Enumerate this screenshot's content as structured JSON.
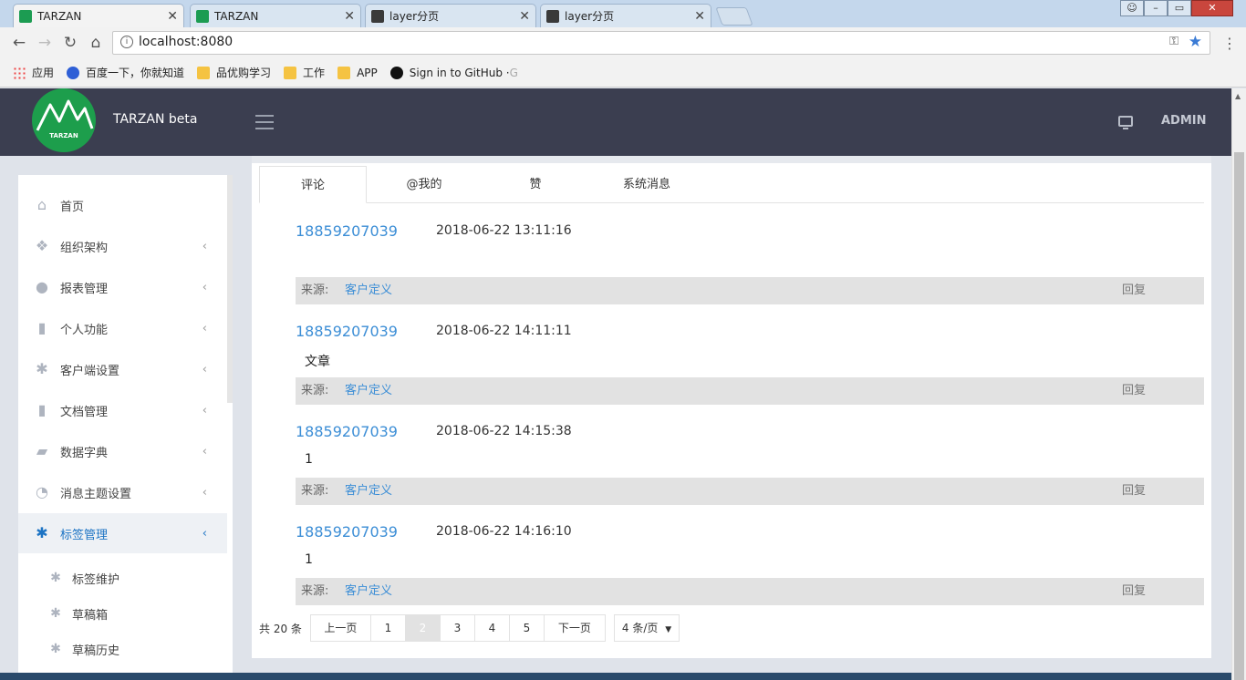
{
  "browser": {
    "tabs": [
      {
        "title": "TARZAN",
        "favicon": "tarzan-icon",
        "active": true
      },
      {
        "title": "TARZAN",
        "favicon": "tarzan-icon",
        "active": false
      },
      {
        "title": "layer分页",
        "favicon": "intellij-icon",
        "active": false
      },
      {
        "title": "layer分页",
        "favicon": "intellij-icon",
        "active": false
      }
    ],
    "close_glyph": "✕",
    "url": "localhost:8080",
    "bookmarks": [
      {
        "label": "应用",
        "icon": "apps-icon"
      },
      {
        "label": "百度一下，你就知道",
        "icon": "baidu-icon"
      },
      {
        "label": "品优购学习",
        "icon": "folder-icon"
      },
      {
        "label": "工作",
        "icon": "folder-icon"
      },
      {
        "label": "APP",
        "icon": "folder-icon"
      },
      {
        "label": "Sign in to GitHub · ",
        "icon": "github-icon"
      }
    ],
    "bookmark_fade": "G"
  },
  "header": {
    "brand": "TARZAN beta",
    "logo_text": "TARZAN",
    "user": "ADMIN",
    "brand_color": "#3b3e50",
    "logo_color": "#1d9e4c"
  },
  "sidebar": {
    "items": [
      {
        "label": "首页",
        "icon": "home-icon",
        "glyph": "⌂",
        "has_children": false
      },
      {
        "label": "组织架构",
        "icon": "cubes-icon",
        "glyph": "❖",
        "has_children": true
      },
      {
        "label": "报表管理",
        "icon": "user-icon",
        "glyph": "●",
        "has_children": true
      },
      {
        "label": "个人功能",
        "icon": "file-icon",
        "glyph": "▮",
        "has_children": true
      },
      {
        "label": "客户端设置",
        "icon": "gear-icon",
        "glyph": "✱",
        "has_children": true
      },
      {
        "label": "文档管理",
        "icon": "file-icon",
        "glyph": "▮",
        "has_children": true
      },
      {
        "label": "数据字典",
        "icon": "folder-open-icon",
        "glyph": "▰",
        "has_children": true
      },
      {
        "label": "消息主题设置",
        "icon": "rss-icon",
        "glyph": "◔",
        "has_children": true
      },
      {
        "label": "标签管理",
        "icon": "gear-icon",
        "glyph": "✱",
        "has_children": true,
        "active": true
      }
    ],
    "sub_items": [
      {
        "label": "标签维护",
        "icon": "gear-icon",
        "glyph": "✱"
      },
      {
        "label": "草稿箱",
        "icon": "gear-icon",
        "glyph": "✱"
      },
      {
        "label": "草稿历史",
        "icon": "gear-icon",
        "glyph": "✱"
      }
    ],
    "chevron": "‹",
    "active_color": "#1d74c4"
  },
  "main": {
    "tabs": [
      "评论",
      "@我的",
      "赞",
      "系统消息"
    ],
    "comments": [
      {
        "user": "18859207039",
        "time": "2018-06-22 13:11:16",
        "body": "",
        "source_label": "来源:",
        "source": "客户定义",
        "reply": "回复"
      },
      {
        "user": "18859207039",
        "time": "2018-06-22 14:11:11",
        "body": "文章",
        "source_label": "来源:",
        "source": "客户定义",
        "reply": "回复"
      },
      {
        "user": "18859207039",
        "time": "2018-06-22 14:15:38",
        "body": "1",
        "source_label": "来源:",
        "source": "客户定义",
        "reply": "回复"
      },
      {
        "user": "18859207039",
        "time": "2018-06-22 14:16:10",
        "body": "1",
        "source_label": "来源:",
        "source": "客户定义",
        "reply": "回复"
      }
    ],
    "pager": {
      "total": "共 20 条",
      "prev": "上一页",
      "pages": [
        "1",
        "2",
        "3",
        "4",
        "5"
      ],
      "current": "2",
      "next": "下一页",
      "page_size": "4 条/页",
      "page_size_arrow": "▼"
    },
    "link_color": "#3c8ed6"
  }
}
